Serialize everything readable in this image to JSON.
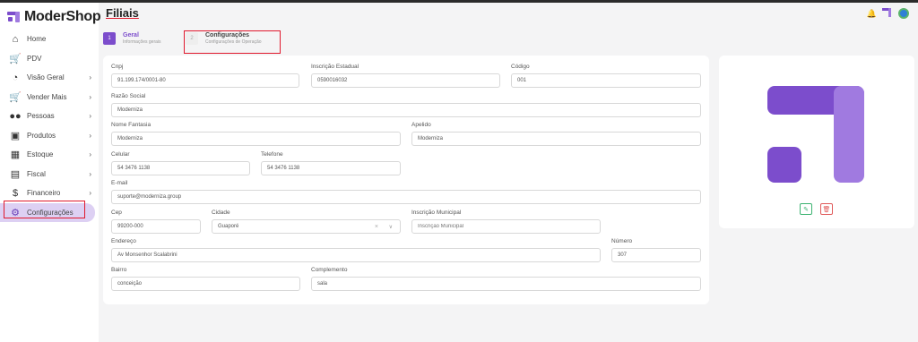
{
  "app": {
    "brand": "ModerShop"
  },
  "header": {
    "title": "Filiais"
  },
  "sidebar": {
    "items": [
      {
        "label": "Home",
        "icon": "home-icon",
        "chevron": false
      },
      {
        "label": "PDV",
        "icon": "cart-icon",
        "chevron": false
      },
      {
        "label": "Visão Geral",
        "icon": "pie-chart-icon",
        "chevron": true
      },
      {
        "label": "Vender Mais",
        "icon": "cart-plus-icon",
        "chevron": true
      },
      {
        "label": "Pessoas",
        "icon": "users-icon",
        "chevron": true
      },
      {
        "label": "Produtos",
        "icon": "box-icon",
        "chevron": true
      },
      {
        "label": "Estoque",
        "icon": "boxes-icon",
        "chevron": true
      },
      {
        "label": "Fiscal",
        "icon": "document-icon",
        "chevron": true
      },
      {
        "label": "Financeiro",
        "icon": "dollar-icon",
        "chevron": true
      },
      {
        "label": "Configurações",
        "icon": "gear-icon",
        "chevron": false,
        "active": true
      }
    ]
  },
  "steps": [
    {
      "number": "1",
      "title": "Geral",
      "subtitle": "Informações gerais"
    },
    {
      "number": "2",
      "title": "Configurações",
      "subtitle": "Configurações de Operação"
    }
  ],
  "form": {
    "cnpj": {
      "label": "Cnpj",
      "value": "91.199.174/0001-80"
    },
    "inscricao_estadual": {
      "label": "Inscrição Estadual",
      "value": "0590016032"
    },
    "codigo": {
      "label": "Código",
      "value": "001"
    },
    "razao_social": {
      "label": "Razão Social",
      "value": "Moderniza"
    },
    "nome_fantasia": {
      "label": "Nome Fantasia",
      "value": "Moderniza"
    },
    "apelido": {
      "label": "Apelido",
      "value": "Moderniza"
    },
    "celular": {
      "label": "Celular",
      "value": "54 3476 1138"
    },
    "telefone": {
      "label": "Telefone",
      "value": "54 3476 1138"
    },
    "email": {
      "label": "E-mail",
      "value": "suporte@moderniza.group"
    },
    "cep": {
      "label": "Cep",
      "value": "99200-000"
    },
    "cidade": {
      "label": "Cidade",
      "value": "Guaporé"
    },
    "inscricao_municipal": {
      "label": "Inscrição Municipal",
      "placeholder": "Inscrição Municipal"
    },
    "endereco": {
      "label": "Endereço",
      "value": "Av Monsenhor Scalabrini"
    },
    "numero": {
      "label": "Número",
      "value": "307"
    },
    "bairro": {
      "label": "Bairro",
      "value": "conceição"
    },
    "complemento": {
      "label": "Complemento",
      "value": "sala"
    }
  },
  "colors": {
    "accent": "#7c4dcc",
    "accent_light": "#a07ae0",
    "highlight": "#e0182d"
  }
}
